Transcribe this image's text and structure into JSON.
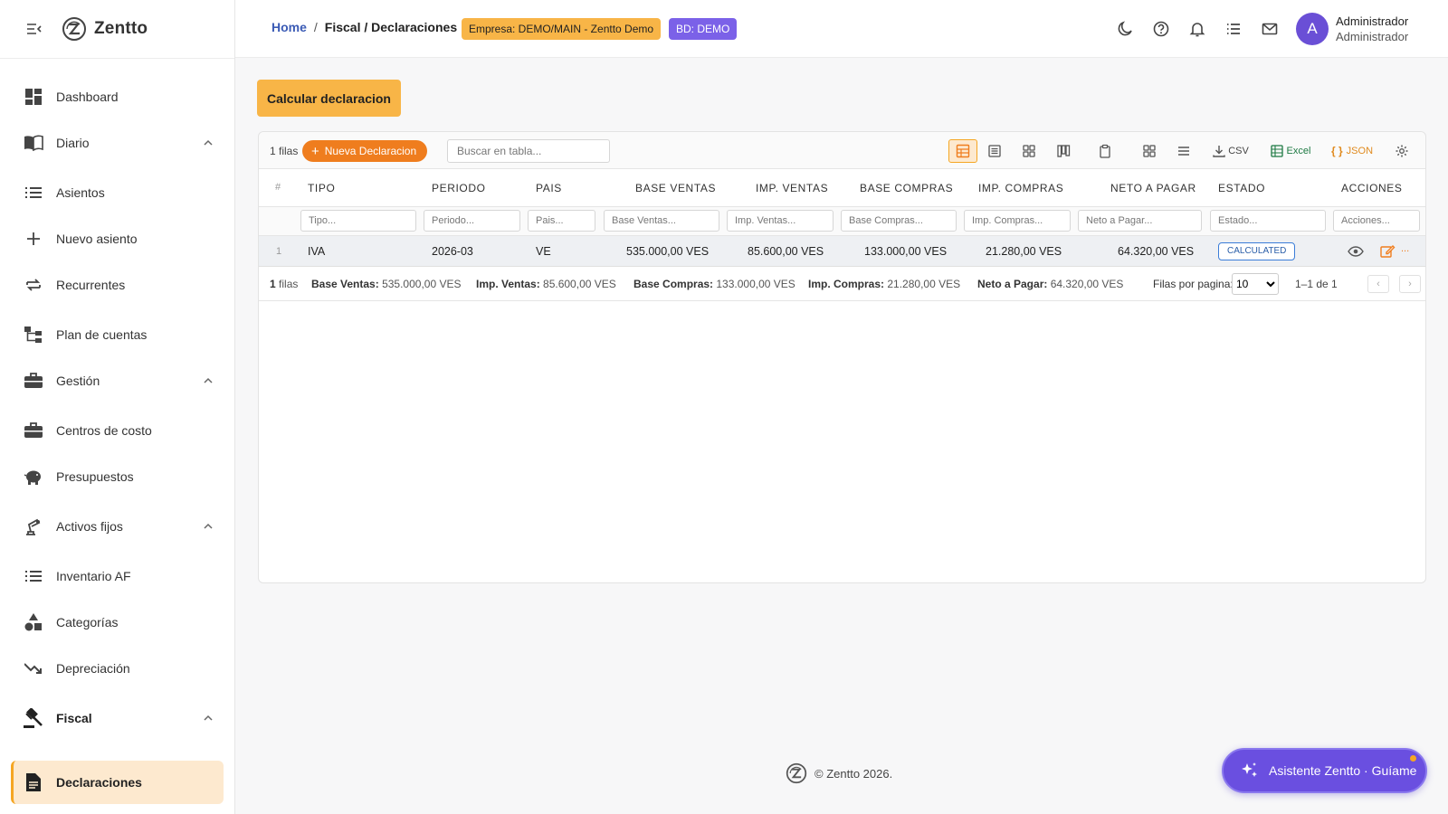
{
  "app": {
    "name": "Zentto"
  },
  "header": {
    "breadcrumb": {
      "home": "Home",
      "separator": "/",
      "current": "Fiscal / Declaraciones"
    },
    "badges": {
      "empresa": "Empresa: DEMO/MAIN - Zentto Demo",
      "bd": "BD: DEMO"
    },
    "user": {
      "initial": "A",
      "name": "Administrador",
      "role": "Administrador"
    },
    "icons": [
      "moon-icon",
      "help-icon",
      "bell-icon",
      "list-icon",
      "mail-icon"
    ]
  },
  "sidebar": {
    "items": [
      {
        "label": "Dashboard",
        "icon": "dashboard-icon"
      },
      {
        "label": "Diario",
        "icon": "book-icon",
        "expanded": true
      },
      {
        "label": "Asientos",
        "icon": "list-icon"
      },
      {
        "label": "Nuevo asiento",
        "icon": "plus-icon"
      },
      {
        "label": "Recurrentes",
        "icon": "repeat-icon"
      },
      {
        "label": "Plan de cuentas",
        "icon": "tree-icon"
      },
      {
        "label": "Gestión",
        "icon": "briefcase-icon",
        "expanded": true
      },
      {
        "label": "Centros de costo",
        "icon": "briefcase-icon"
      },
      {
        "label": "Presupuestos",
        "icon": "piggy-bank-icon"
      },
      {
        "label": "Activos fijos",
        "icon": "precision-icon",
        "expanded": true
      },
      {
        "label": "Inventario AF",
        "icon": "list-icon"
      },
      {
        "label": "Categorías",
        "icon": "category-icon"
      },
      {
        "label": "Depreciación",
        "icon": "trending-down-icon"
      },
      {
        "label": "Fiscal",
        "icon": "gavel-icon",
        "expanded": true
      },
      {
        "label": "Declaraciones",
        "icon": "document-icon",
        "active": true
      }
    ]
  },
  "main": {
    "calc_button": "Calcular declaracion",
    "grid": {
      "row_count": "1 filas",
      "new_button": "Nueva Declaracion",
      "search_placeholder": "Buscar en tabla...",
      "toolbar": {
        "csv": "CSV",
        "excel": "Excel",
        "json": "JSON"
      },
      "columns": [
        "#",
        "TIPO",
        "PERIODO",
        "PAIS",
        "BASE VENTAS",
        "IMP. VENTAS",
        "BASE COMPRAS",
        "IMP. COMPRAS",
        "NETO A PAGAR",
        "ESTADO",
        "ACCIONES"
      ],
      "filters": [
        "Tipo...",
        "Periodo...",
        "Pais...",
        "Base Ventas...",
        "Imp. Ventas...",
        "Base Compras...",
        "Imp. Compras...",
        "Neto a Pagar...",
        "Estado...",
        "Acciones..."
      ],
      "rows": [
        {
          "index": "1",
          "tipo": "IVA",
          "periodo": "2026-03",
          "pais": "VE",
          "base_ventas": "535.000,00 VES",
          "imp_ventas": "85.600,00 VES",
          "base_compras": "133.000,00 VES",
          "imp_compras": "21.280,00 VES",
          "neto": "64.320,00 VES",
          "estado": "CALCULATED",
          "more": "..."
        }
      ],
      "summary": {
        "count_num": "1",
        "count_lbl": "filas",
        "base_ventas_lbl": "Base Ventas:",
        "base_ventas": "535.000,00 VES",
        "imp_ventas_lbl": "Imp. Ventas:",
        "imp_ventas": "85.600,00 VES",
        "base_compras_lbl": "Base Compras:",
        "base_compras": "133.000,00 VES",
        "imp_compras_lbl": "Imp. Compras:",
        "imp_compras": "21.280,00 VES",
        "neto_lbl": "Neto a Pagar:",
        "neto": "64.320,00 VES"
      },
      "pagination": {
        "rows_per_page_label": "Filas por pagina:",
        "rows_per_page": "10",
        "range": "1–1 de 1"
      }
    }
  },
  "footer": {
    "copyright": "© Zentto 2026."
  },
  "assistant": {
    "label": "Asistente Zentto · Guíame"
  },
  "colors": {
    "accent": "#f8b547",
    "orange": "#ef7d1e",
    "purple": "#6a4fe0",
    "link": "#3b5bb5"
  }
}
